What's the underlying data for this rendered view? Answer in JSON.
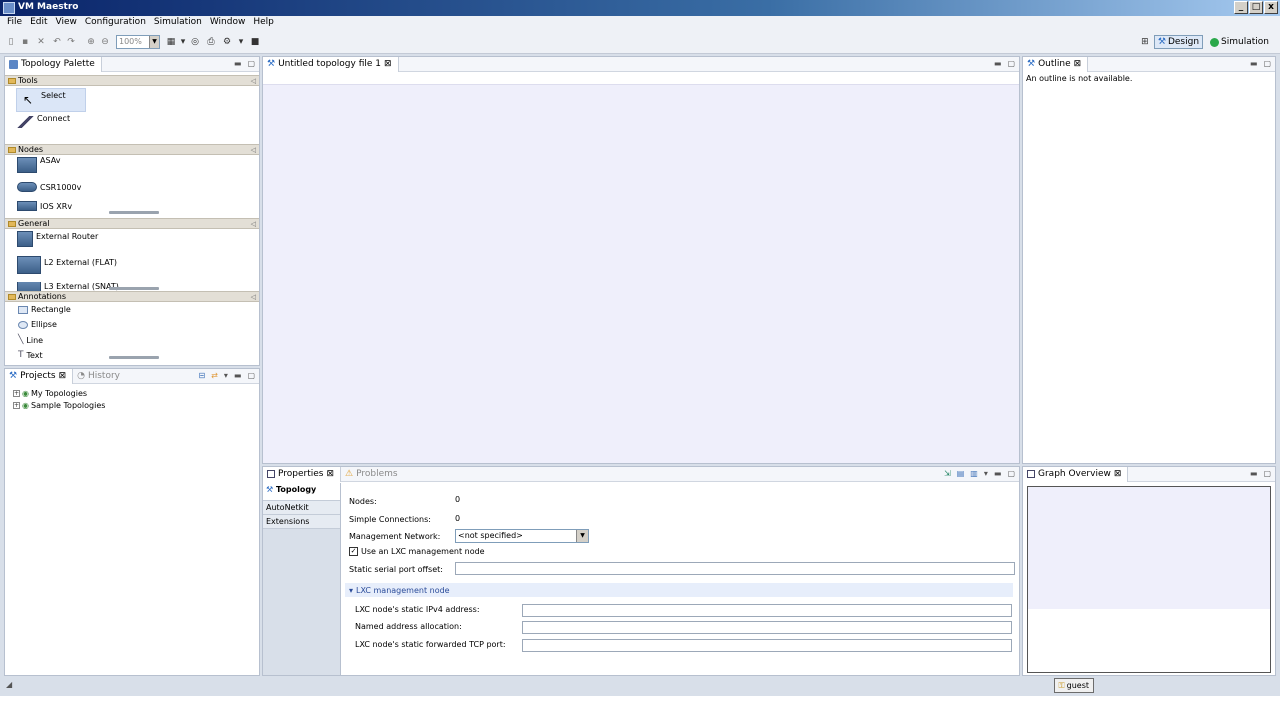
{
  "window": {
    "title": "VM Maestro",
    "controls": [
      "_",
      "□",
      "x"
    ]
  },
  "menu": [
    "File",
    "Edit",
    "View",
    "Configuration",
    "Simulation",
    "Window",
    "Help"
  ],
  "toolbar": {
    "zoom_value": "100%",
    "perspectives": [
      {
        "label": "Design",
        "icon": "design-perspective-icon",
        "active": true
      },
      {
        "label": "Simulation",
        "icon": "simulation-perspective-icon",
        "active": false
      }
    ]
  },
  "palette": {
    "title": "Topology Palette",
    "drawers": {
      "tools": {
        "label": "Tools",
        "items": [
          {
            "label": "Select"
          },
          {
            "label": "Connect"
          }
        ]
      },
      "nodes": {
        "label": "Nodes",
        "items": [
          {
            "label": "ASAv"
          },
          {
            "label": "CSR1000v"
          },
          {
            "label": "IOS XRv"
          }
        ]
      },
      "general": {
        "label": "General",
        "items": [
          {
            "label": "External Router"
          },
          {
            "label": "L2 External (FLAT)"
          },
          {
            "label": "L3 External (SNAT)"
          }
        ]
      },
      "annotations": {
        "label": "Annotations",
        "items": [
          {
            "label": "Rectangle"
          },
          {
            "label": "Ellipse"
          },
          {
            "label": "Line"
          },
          {
            "label": "Text"
          }
        ]
      }
    }
  },
  "projects": {
    "tabs": [
      {
        "label": "Projects"
      },
      {
        "label": "History"
      }
    ],
    "tree": [
      {
        "label": "My Topologies"
      },
      {
        "label": "Sample Topologies"
      }
    ]
  },
  "editor": {
    "tab_label": "Untitled topology file 1"
  },
  "outline": {
    "tab_label": "Outline",
    "message": "An outline is not available."
  },
  "properties": {
    "tabs": [
      {
        "label": "Properties"
      },
      {
        "label": "Problems"
      }
    ],
    "side_tabs": [
      {
        "label": "Topology"
      },
      {
        "label": "AutoNetkit"
      },
      {
        "label": "Extensions"
      }
    ],
    "fields": {
      "nodes_label": "Nodes:",
      "nodes_value": "0",
      "simple_conn_label": "Simple Connections:",
      "simple_conn_value": "0",
      "mgmt_network_label": "Management Network:",
      "mgmt_network_value": "<not specified>",
      "lxc_checkbox_label": "Use an LXC management node",
      "static_serial_label": "Static serial port offset:"
    },
    "lxc_section": {
      "title": "LXC management node",
      "ipv4_label": "LXC node's static IPv4 address:",
      "named_label": "Named address allocation:",
      "tcp_label": "LXC node's static forwarded TCP port:"
    }
  },
  "graph_overview": {
    "tab_label": "Graph Overview"
  },
  "status": {
    "user": "guest"
  }
}
